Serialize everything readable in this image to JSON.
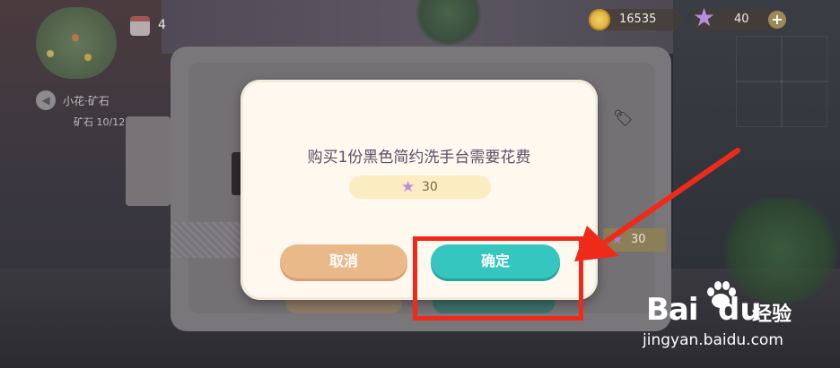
{
  "hud": {
    "calendar_count": "4",
    "location_label": "小花·矿石",
    "ore_label": "矿石 10/12",
    "coins": "16535",
    "stars": "40",
    "plus": "+"
  },
  "shop": {
    "price_star": "★",
    "price": "30"
  },
  "dialog": {
    "message": "购买1份黑色简约洗手台需要花费",
    "price_star": "★",
    "price": "30",
    "cancel_label": "取消",
    "confirm_label": "确定"
  },
  "watermark": {
    "brand_bai": "Bai",
    "brand_du": "du",
    "brand_suffix": "经验",
    "url": "jingyan.baidu.com"
  },
  "colors": {
    "confirm": "#35c7bf",
    "cancel": "#eab98a",
    "annotation": "#f02a1a",
    "star": "#b88ee3"
  }
}
